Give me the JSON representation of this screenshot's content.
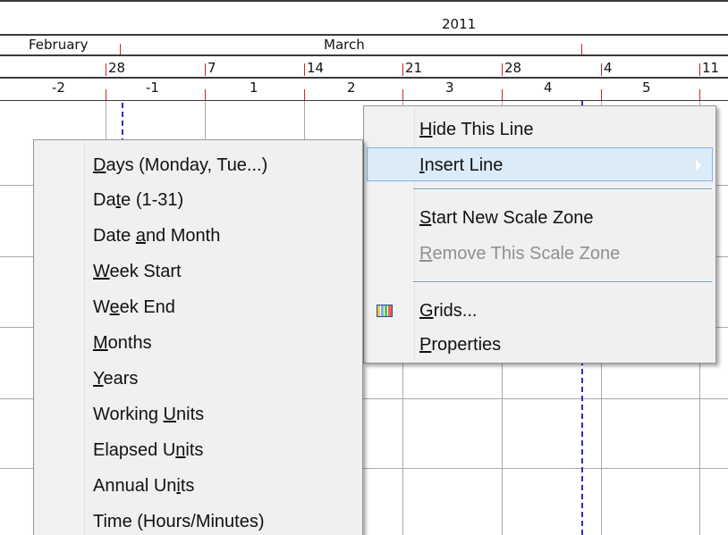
{
  "timescale": {
    "year": "2011",
    "months": [
      "February",
      "March"
    ],
    "week_starts": [
      "28",
      "7",
      "14",
      "21",
      "28",
      "4",
      "11"
    ],
    "week_numbers": [
      "-2",
      "-1",
      "1",
      "2",
      "3",
      "4",
      "5"
    ]
  },
  "context_menu": {
    "items": [
      {
        "pre": "",
        "key": "H",
        "post": "ide This Line"
      },
      {
        "pre": "",
        "key": "I",
        "post": "nsert Line"
      },
      {
        "pre": "",
        "key": "S",
        "post": "tart New Scale Zone"
      },
      {
        "pre": "",
        "key": "R",
        "post": "emove This Scale Zone"
      },
      {
        "pre": "",
        "key": "G",
        "post": "rids..."
      },
      {
        "pre": "",
        "key": "P",
        "post": "roperties"
      }
    ],
    "icons": {
      "grids": "grid-icon",
      "submenu": "submenu-arrow-icon"
    }
  },
  "insert_line_submenu": {
    "items": [
      {
        "pre": "",
        "key": "D",
        "post": "ays (Monday, Tue...)"
      },
      {
        "pre": "Da",
        "key": "t",
        "post": "e (1-31)"
      },
      {
        "pre": "Date ",
        "key": "a",
        "post": "nd Month"
      },
      {
        "pre": "",
        "key": "W",
        "post": "eek Start"
      },
      {
        "pre": "W",
        "key": "e",
        "post": "ek End"
      },
      {
        "pre": "",
        "key": "M",
        "post": "onths"
      },
      {
        "pre": "",
        "key": "Y",
        "post": "ears"
      },
      {
        "pre": "Working ",
        "key": "U",
        "post": "nits"
      },
      {
        "pre": "Elapsed U",
        "key": "n",
        "post": "its"
      },
      {
        "pre": "Annual Un",
        "key": "i",
        "post": "ts"
      },
      {
        "pre": "Time (Hours/Minutes)",
        "key": "",
        "post": ""
      }
    ]
  },
  "colors": {
    "tick": "#d42020",
    "today_line": "#2a2ad8",
    "highlight": "#dcebf8",
    "highlight_border": "#7eb4ea",
    "menu_background": "#f0f0f0"
  }
}
